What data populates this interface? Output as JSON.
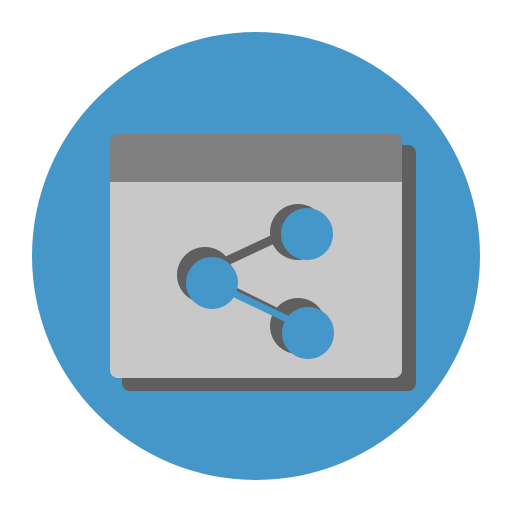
{
  "icon": {
    "name": "share-window-icon",
    "colors": {
      "circle": "#4597C9",
      "window_body": "#C8C8C8",
      "window_titlebar": "#808080",
      "shadow": "#5F5F5F",
      "node_fill": "#4597C9",
      "connector": "#5F5F5F"
    }
  }
}
